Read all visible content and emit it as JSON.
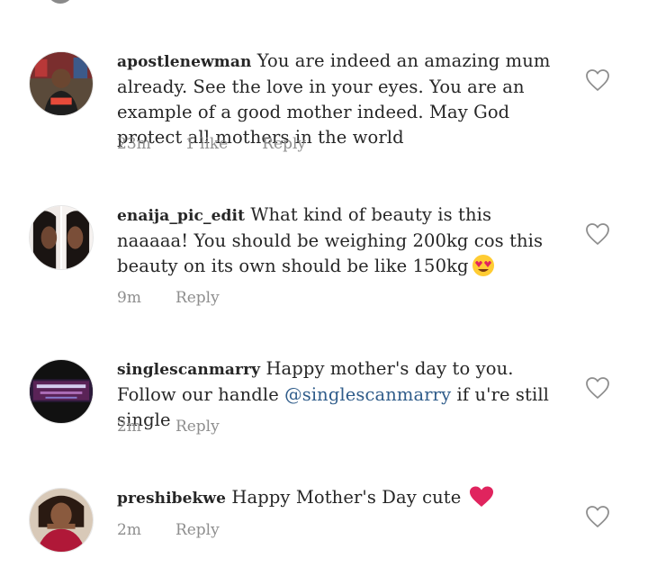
{
  "comments": [
    {
      "username": "apostlenewman",
      "text": "You are indeed an amazing mum already. See the love in your eyes. You are an example of a good mother indeed. May God protect all mothers in the world",
      "time": "23m",
      "likes": "1 like",
      "reply_label": "Reply",
      "avatar_icon": "profile-photo"
    },
    {
      "username": "enaija_pic_edit",
      "text": "What kind of beauty is this naaaaa! You should be weighing 200kg cos this beauty on its own should be like 150kg",
      "emoji": "heart-eyes-emoji",
      "time": "9m",
      "reply_label": "Reply",
      "avatar_icon": "profile-photo"
    },
    {
      "username": "singlescanmarry",
      "text_before": "Happy mother's day to you. Follow our handle ",
      "mention": "@singlescanmarry",
      "text_after": " if u're still single",
      "time": "2m",
      "reply_label": "Reply",
      "avatar_icon": "profile-photo"
    },
    {
      "username": "preshibekwe",
      "text": "Happy Mother's Day cute",
      "emoji": "red-heart-emoji",
      "time": "2m",
      "reply_label": "Reply",
      "avatar_icon": "profile-photo"
    }
  ],
  "colors": {
    "text": "#262626",
    "meta": "#8e8e8e",
    "mention": "#2f5c8a",
    "heart_outline": "#8e8e8e",
    "red_heart": "#e0245e"
  }
}
